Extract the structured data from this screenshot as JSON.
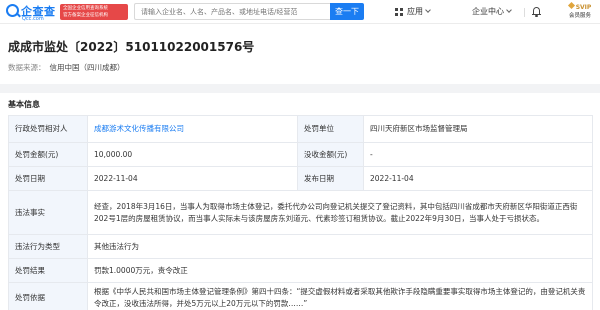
{
  "header": {
    "logo_cn": "企查查",
    "logo_en": "Qcc.com",
    "badge_line1": "全国企业信用查询系统",
    "badge_line2": "官方备案企业征信机构",
    "search_placeholder": "请输入企业名、人名、产品名、或地址电话/经营范",
    "search_button": "查一下",
    "nav_app": "应用",
    "nav_enterprise_center": "企业中心",
    "vip_top": "SVIP",
    "vip_bottom": "会员服务"
  },
  "record": {
    "title": "成成市监处〔2022〕51011022001576号",
    "source_label": "数据来源：",
    "source_value": "信用中国（四川成都）"
  },
  "section_title": "基本信息",
  "info_table": {
    "row1": {
      "label_a": "行政处罚相对人",
      "value_a": "成都游术文化传播有限公司",
      "label_b": "处罚单位",
      "value_b": "四川天府新区市场监督管理局"
    },
    "row2": {
      "label_a": "处罚金额(元)",
      "value_a": "10,000.00",
      "label_b": "没收金额(元)",
      "value_b": "-"
    },
    "row3": {
      "label_a": "处罚日期",
      "value_a": "2022-11-04",
      "label_b": "发布日期",
      "value_b": "2022-11-04"
    },
    "row4": {
      "label": "违法事实",
      "value": "经查，2018年3月16日，当事人为取得市场主体登记，委托代办公司向登记机关提交了登记资料，其中包括四川省成都市天府新区华阳街道正西街202号1层的房屋租赁协议，而当事人实际未与该房屋房东刘道元、代素珍签订租赁协议。截止2022年9月30日，当事人处于亏损状态。"
    },
    "row5": {
      "label": "违法行为类型",
      "value": "其他违法行为"
    },
    "row6": {
      "label": "处罚结果",
      "value": "罚款1.0000万元，责令改正"
    },
    "row7": {
      "label": "处罚依据",
      "value": "根据《中华人民共和国市场主体登记管理条例》第四十四条：“提交虚假材料或者采取其他欺诈手段隐瞒重要事实取得市场主体登记的，由登记机关责令改正，没收违法所得，并处5万元以上20万元以下的罚款……”"
    }
  },
  "colors": {
    "brand_blue": "#1b7df2",
    "badge_red": "#e64848",
    "label_bg": "#f2f6fc",
    "vip_gold": "#c8902f"
  }
}
